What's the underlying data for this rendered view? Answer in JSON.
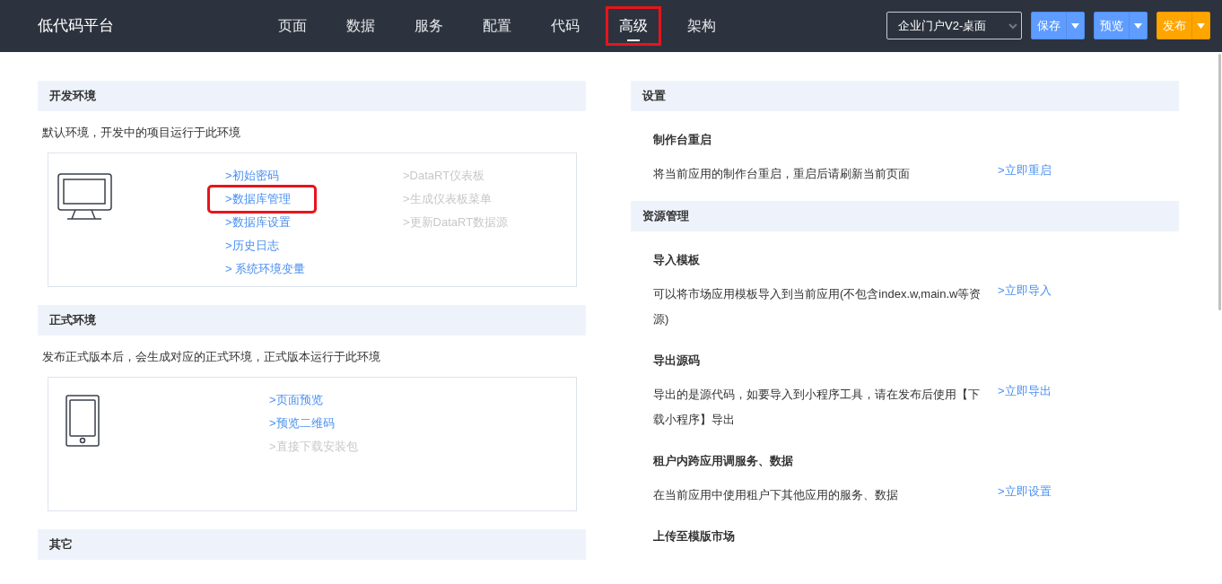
{
  "header": {
    "logo": "低代码平台",
    "nav": [
      {
        "label": "页面",
        "selected": false,
        "highlighted": false
      },
      {
        "label": "数据",
        "selected": false,
        "highlighted": false
      },
      {
        "label": "服务",
        "selected": false,
        "highlighted": false
      },
      {
        "label": "配置",
        "selected": false,
        "highlighted": false
      },
      {
        "label": "代码",
        "selected": false,
        "highlighted": false
      },
      {
        "label": "高级",
        "selected": true,
        "highlighted": true
      },
      {
        "label": "架构",
        "selected": false,
        "highlighted": false
      }
    ],
    "app_select": {
      "value": "企业门户V2-桌面"
    },
    "buttons": [
      {
        "label": "保存",
        "kind": "primary"
      },
      {
        "label": "预览",
        "kind": "primary"
      },
      {
        "label": "发布",
        "kind": "warning"
      }
    ]
  },
  "left": [
    {
      "title": "开发环境",
      "description": "默认环境，开发中的项目运行于此环境",
      "kind": "monitor",
      "link_columns": [
        [
          {
            "label": ">初始密码",
            "disabled": false,
            "highlighted": false
          },
          {
            "label": ">数据库管理",
            "disabled": false,
            "highlighted": true
          },
          {
            "label": ">数据库设置",
            "disabled": false,
            "highlighted": false
          },
          {
            "label": ">历史日志",
            "disabled": false,
            "highlighted": false
          },
          {
            "label": "> 系统环境变量",
            "disabled": false,
            "highlighted": false
          }
        ],
        [
          {
            "label": ">DataRT仪表板",
            "disabled": true,
            "highlighted": false
          },
          {
            "label": ">生成仪表板菜单",
            "disabled": true,
            "highlighted": false
          },
          {
            "label": ">更新DataRT数据源",
            "disabled": true,
            "highlighted": false
          }
        ]
      ]
    },
    {
      "title": "正式环境",
      "description": "发布正式版本后，会生成对应的正式环境，正式版本运行于此环境",
      "kind": "tablet",
      "link_columns": [
        [
          {
            "label": ">页面预览",
            "disabled": false,
            "highlighted": false
          },
          {
            "label": ">预览二维码",
            "disabled": false,
            "highlighted": false
          },
          {
            "label": ">直接下载安装包",
            "disabled": true,
            "highlighted": false
          }
        ]
      ]
    },
    {
      "title": "其它"
    }
  ],
  "right": [
    {
      "title": "设置",
      "items": [
        {
          "title": "制作台重启",
          "description": "将当前应用的制作台重启，重启后请刷新当前页面",
          "action": ">立即重启"
        }
      ]
    },
    {
      "title": "资源管理",
      "items": [
        {
          "title": "导入模板",
          "description": "可以将市场应用模板导入到当前应用(不包含index.w,main.w等资源)",
          "action": ">立即导入"
        },
        {
          "title": "导出源码",
          "description": "导出的是源代码，如要导入到小程序工具，请在发布后使用【下载小程序】导出",
          "action": ">立即导出"
        },
        {
          "title": "租户内跨应用调服务、数据",
          "description": "在当前应用中使用租户下其他应用的服务、数据",
          "action": ">立即设置"
        },
        {
          "title": "上传至模版市场"
        }
      ]
    }
  ]
}
